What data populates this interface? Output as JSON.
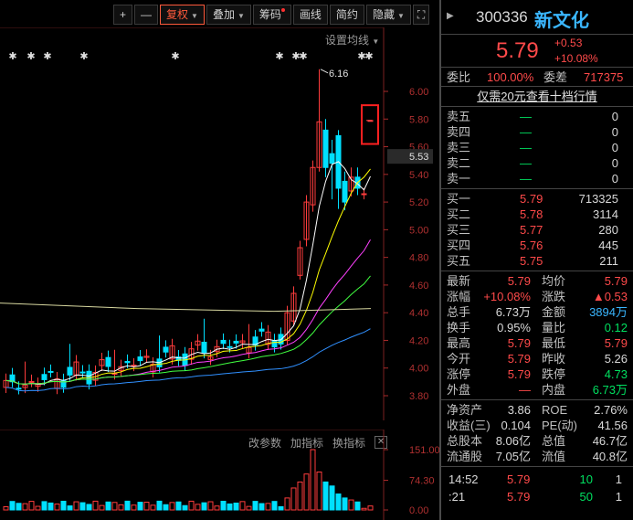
{
  "toolbar": {
    "plus": "+",
    "minus": "—",
    "fuquan": "复权",
    "diejia": "叠加",
    "chouma": "筹码",
    "huaxian": "画线",
    "jianyue": "简约",
    "yincang": "隐藏",
    "expand": "⛶"
  },
  "chart": {
    "setting_ma": "设置均线",
    "high_marker": "6.16",
    "current_price_tag": "5.53",
    "price_ticks": [
      "6.00",
      "5.80",
      "5.60",
      "5.40",
      "5.20",
      "5.00",
      "4.80",
      "4.60",
      "4.40",
      "4.20",
      "4.00",
      "3.80"
    ],
    "volume_ticks": [
      "151.00",
      "74.30",
      "0.00"
    ],
    "indicator_bar": {
      "change_params": "改参数",
      "add_indicator": "加指标",
      "switch_indicator": "换指标",
      "close": "✕"
    },
    "colors": {
      "up": "#ff3c3c",
      "down": "#00e0ff",
      "ma5": "#ffffff",
      "ma10": "#ffff00",
      "ma20": "#ff40ff",
      "ma30": "#40ff40",
      "ma60": "#3090ff",
      "ma250": "#d8d8a0"
    }
  },
  "panel": {
    "collapse_icon": "collapse-arrow",
    "code": "300336",
    "name": "新文化",
    "price": "5.79",
    "change": "+0.53",
    "change_pct": "+10.08%",
    "weibi_label": "委比",
    "weibi": "100.00%",
    "weicha_label": "委差",
    "weicha": "717375",
    "upgrade_text": "仅需20元查看十档行情",
    "sell": [
      {
        "label": "卖五",
        "price": "—",
        "vol": "0"
      },
      {
        "label": "卖四",
        "price": "—",
        "vol": "0"
      },
      {
        "label": "卖三",
        "price": "—",
        "vol": "0"
      },
      {
        "label": "卖二",
        "price": "—",
        "vol": "0"
      },
      {
        "label": "卖一",
        "price": "—",
        "vol": "0"
      }
    ],
    "buy": [
      {
        "label": "买一",
        "price": "5.79",
        "vol": "713325"
      },
      {
        "label": "买二",
        "price": "5.78",
        "vol": "3114"
      },
      {
        "label": "买三",
        "price": "5.77",
        "vol": "280"
      },
      {
        "label": "买四",
        "price": "5.76",
        "vol": "445"
      },
      {
        "label": "买五",
        "price": "5.75",
        "vol": "211"
      }
    ],
    "stats": [
      {
        "l1": "最新",
        "v1": "5.79",
        "c1": "red",
        "l2": "均价",
        "v2": "5.79",
        "c2": "red"
      },
      {
        "l1": "涨幅",
        "v1": "+10.08%",
        "c1": "red",
        "l2": "涨跌",
        "v2": "▲0.53",
        "c2": "red"
      },
      {
        "l1": "总手",
        "v1": "6.73万",
        "c1": "white",
        "l2": "金额",
        "v2": "3894万",
        "c2": "cyan"
      },
      {
        "l1": "换手",
        "v1": "0.95%",
        "c1": "white",
        "l2": "量比",
        "v2": "0.12",
        "c2": "green"
      },
      {
        "l1": "最高",
        "v1": "5.79",
        "c1": "red",
        "l2": "最低",
        "v2": "5.79",
        "c2": "red"
      },
      {
        "l1": "今开",
        "v1": "5.79",
        "c1": "red",
        "l2": "昨收",
        "v2": "5.26",
        "c2": "white"
      },
      {
        "l1": "涨停",
        "v1": "5.79",
        "c1": "red",
        "l2": "跌停",
        "v2": "4.73",
        "c2": "green"
      },
      {
        "l1": "外盘",
        "v1": "—",
        "c1": "red",
        "l2": "内盘",
        "v2": "6.73万",
        "c2": "green"
      }
    ],
    "fundamentals": [
      {
        "l1": "净资产",
        "v1": "3.86",
        "l2": "ROE",
        "v2": "2.76%"
      },
      {
        "l1": "收益(三)",
        "v1": "0.104",
        "l2": "PE(动)",
        "v2": "41.56"
      },
      {
        "l1": "总股本",
        "v1": "8.06亿",
        "l2": "总值",
        "v2": "46.7亿"
      },
      {
        "l1": "流通股",
        "v1": "7.05亿",
        "l2": "流值",
        "v2": "40.8亿"
      }
    ],
    "ticks": [
      {
        "time": "14:52",
        "price": "5.79",
        "vol": "10",
        "n": "1"
      },
      {
        "time": ":21",
        "price": "5.79",
        "vol": "50",
        "n": "1"
      }
    ]
  }
}
